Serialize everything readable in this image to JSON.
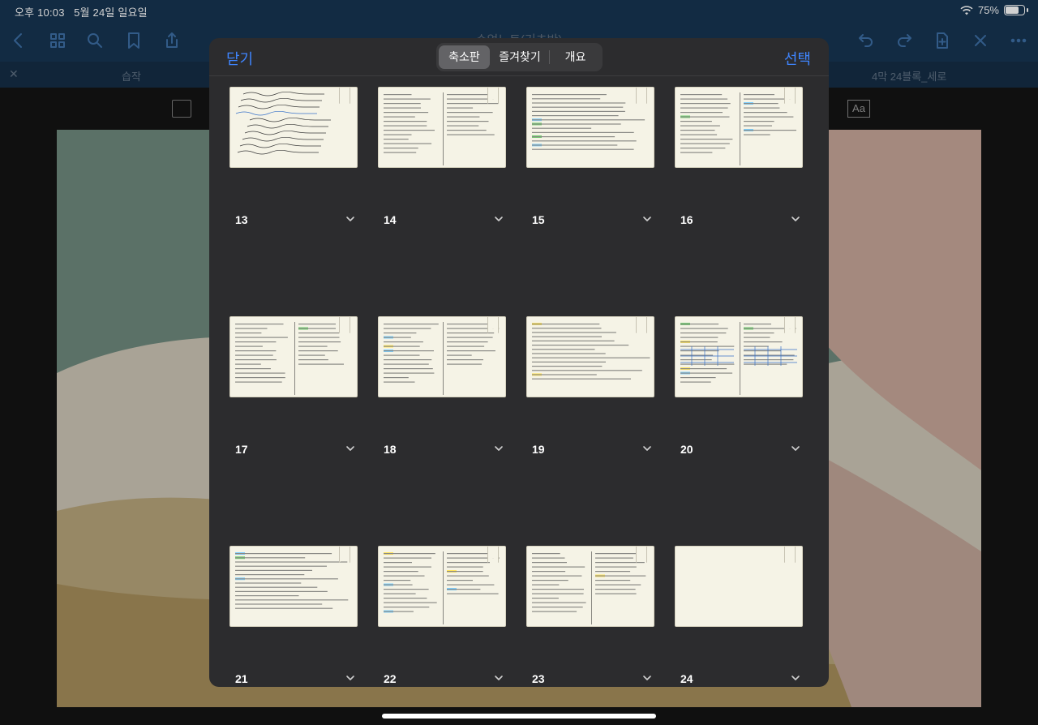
{
  "status": {
    "time": "오후 10:03",
    "date": "5월 24일 일요일",
    "battery_label": "75%",
    "battery_level": 0.75
  },
  "toolbar": {
    "doc_title": "수업노트(기초반)",
    "icons": [
      "back-icon",
      "grid-icon",
      "search-icon",
      "bookmark-icon",
      "share-icon",
      "undo-icon",
      "redo-icon",
      "add-page-icon",
      "pen-off-icon",
      "more-icon"
    ]
  },
  "tabs": {
    "left_label": "습작",
    "right_label": "4막 24블록_세로"
  },
  "sheet": {
    "close_label": "닫기",
    "select_label": "선택",
    "segments": [
      "축소판",
      "즐겨찾기",
      "개요"
    ],
    "active_segment": 0
  },
  "pages": [
    {
      "number": "13"
    },
    {
      "number": "14"
    },
    {
      "number": "15"
    },
    {
      "number": "16"
    },
    {
      "number": "17"
    },
    {
      "number": "18"
    },
    {
      "number": "19"
    },
    {
      "number": "20"
    },
    {
      "number": "21"
    },
    {
      "number": "22"
    },
    {
      "number": "23"
    },
    {
      "number": "24"
    }
  ],
  "colors": {
    "accent": "#3f85ff",
    "toolbar_bg": "#173552",
    "sheet_bg": "#2c2c2e",
    "paper": "#f5f3e6"
  }
}
